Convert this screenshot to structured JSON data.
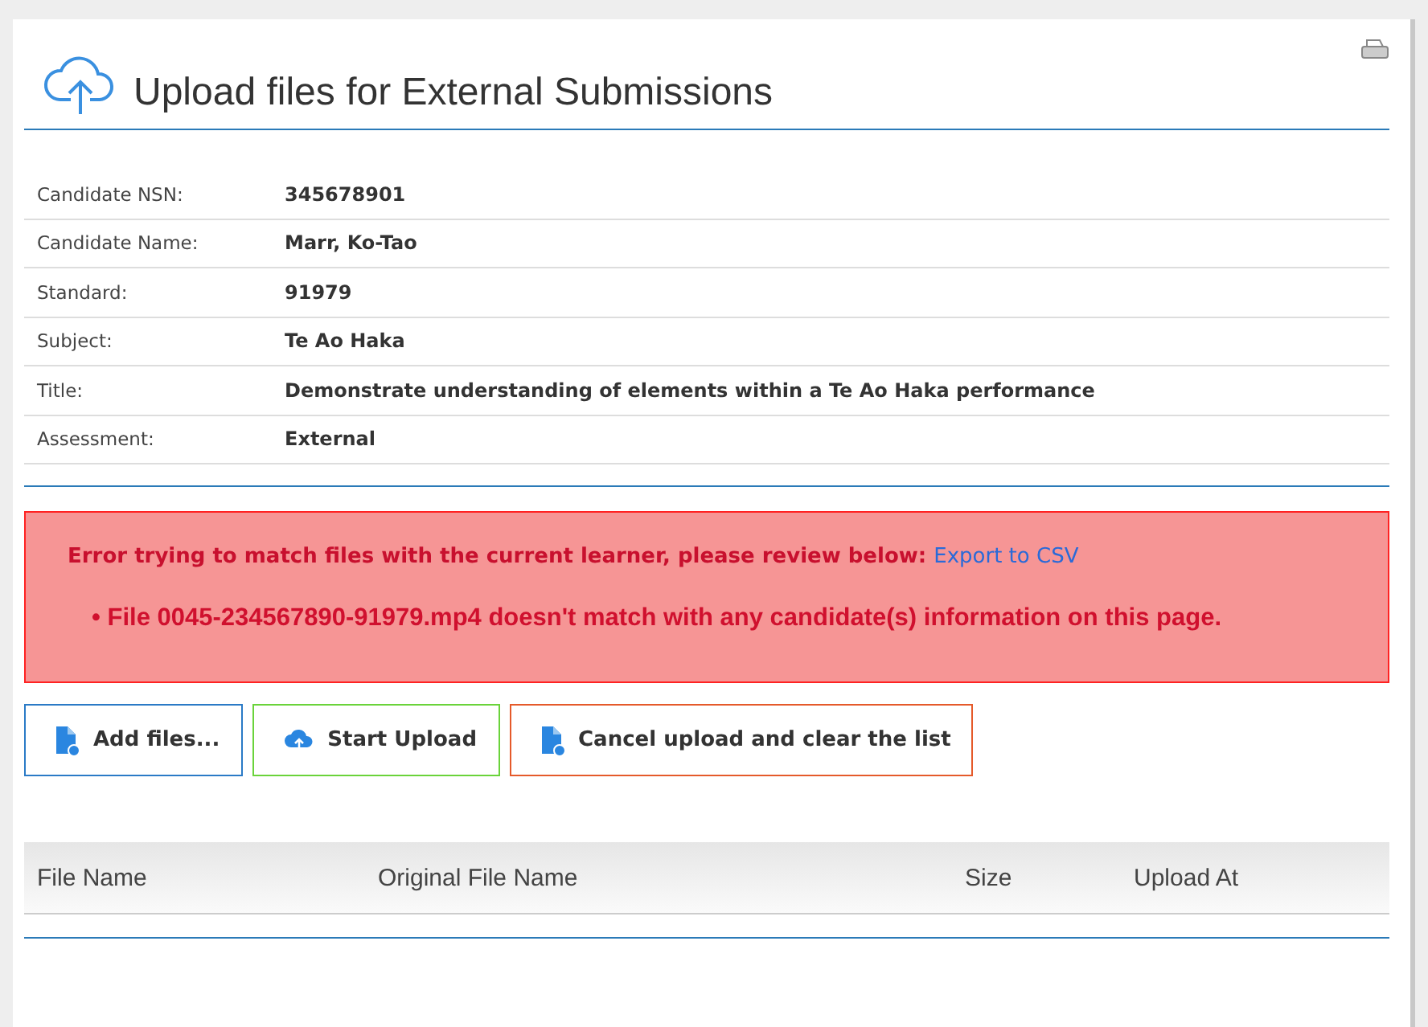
{
  "header": {
    "title": "Upload files for External Submissions"
  },
  "details": [
    {
      "label": "Candidate NSN:",
      "value": "345678901"
    },
    {
      "label": "Candidate Name:",
      "value": "Marr, Ko-Tao"
    },
    {
      "label": "Standard:",
      "value": "91979"
    },
    {
      "label": "Subject:",
      "value": "Te Ao Haka"
    },
    {
      "label": "Title:",
      "value": "Demonstrate understanding of elements within a Te Ao Haka performance"
    },
    {
      "label": "Assessment:",
      "value": "External"
    }
  ],
  "error": {
    "message": "Error trying to match files with the current learner, please review below:",
    "link": "Export to CSV",
    "items": [
      "• File 0045-234567890-91979.mp4 doesn't match with any candidate(s) information on this page."
    ]
  },
  "buttons": [
    {
      "kind": "add",
      "label": "Add files..."
    },
    {
      "kind": "start",
      "label": "Start Upload"
    },
    {
      "kind": "cancel",
      "label": "Cancel upload and clear the list"
    }
  ],
  "table": {
    "columns": [
      "File Name",
      "Original File Name",
      "Size",
      "Upload At"
    ]
  }
}
